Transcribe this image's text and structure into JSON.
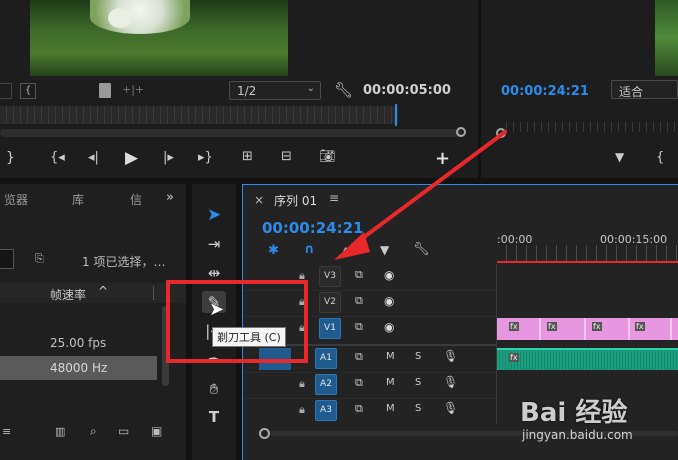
{
  "program_monitor": {
    "timecode": "00:00:05:00",
    "resolution": "1/2"
  },
  "source_monitor": {
    "timecode": "00:00:24:21",
    "fit": "适合"
  },
  "project_panel": {
    "tabs": [
      "览器",
      "库",
      "信"
    ],
    "selection_status": "1 项已选择，…",
    "column_header": "帧速率",
    "row1_value": "25.00 fps",
    "row2_value": "48000 Hz"
  },
  "timeline": {
    "tab_label": "序列 01",
    "close_glyph": "×",
    "menu_glyph": "≡",
    "timecode": "00:00:24:21",
    "ruler_labels": [
      ":00:00",
      "00:00:15:00"
    ],
    "video_tracks": [
      "V3",
      "V2",
      "V1"
    ],
    "audio_tracks": [
      "A1",
      "A2",
      "A3"
    ],
    "mute_label": "M",
    "solo_label": "S",
    "clip_fx": "fx"
  },
  "tooltip": {
    "text": "剃刀工具 (C)"
  },
  "watermark": {
    "brand": "Bai 经验",
    "url": "jingyan.baidu.com"
  },
  "colors": {
    "accent_blue": "#2d8ceb",
    "annotation_red": "#e8282b",
    "video_clip": "#e796e0",
    "audio_clip": "#1c9f80"
  }
}
